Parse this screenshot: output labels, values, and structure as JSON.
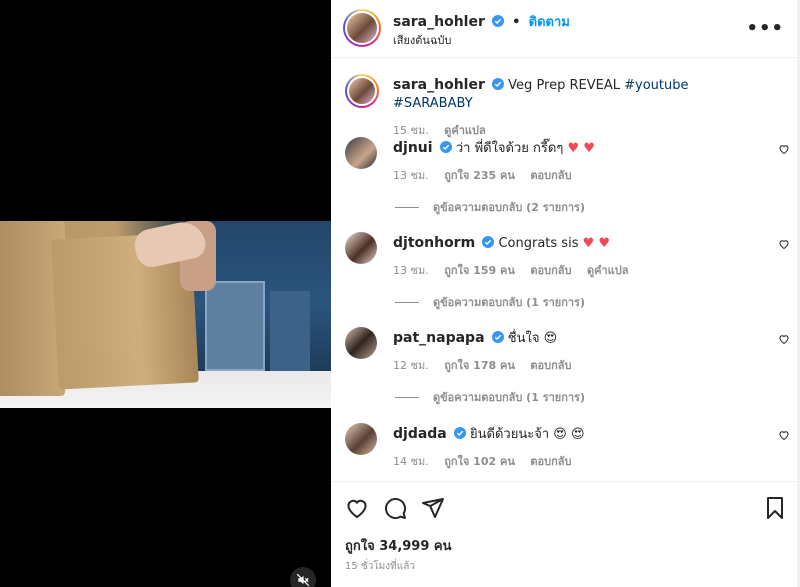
{
  "header": {
    "username": "sara_hohler",
    "follow_label": "ติดตาม",
    "dot": "•",
    "audio": "เสียงต้นฉบับ",
    "more": "•••"
  },
  "caption": {
    "username": "sara_hohler",
    "text": "Veg Prep REVEAL",
    "hashtags": "#youtube #SARABABY",
    "time": "15 ชม.",
    "translate": "ดูคำแปล"
  },
  "comments": [
    {
      "username": "djnui",
      "text": "ว่า พี่ดีใจด้วย กรี๊ดๆ",
      "emoji": "♥ ♥",
      "time": "13 ชม.",
      "likes": "ถูกใจ 235 คน",
      "reply": "ตอบกลับ",
      "view_replies": "ดูข้อความตอบกลับ (2 รายการ)"
    },
    {
      "username": "djtonhorm",
      "text": "Congrats sis",
      "emoji": "♥ ♥",
      "time": "13 ชม.",
      "likes": "ถูกใจ 159 คน",
      "reply": "ตอบกลับ",
      "translate": "ดูคำแปล",
      "view_replies": "ดูข้อความตอบกลับ (1 รายการ)"
    },
    {
      "username": "pat_napapa",
      "text": "ชื่นใจ",
      "emoji": "😍",
      "time": "12 ชม.",
      "likes": "ถูกใจ 178 คน",
      "reply": "ตอบกลับ",
      "view_replies": "ดูข้อความตอบกลับ (1 รายการ)"
    },
    {
      "username": "djdada",
      "text": "ยินดีด้วยนะจ้า",
      "emoji": "😍 😍",
      "time": "14 ชม.",
      "likes": "ถูกใจ 102 คน",
      "reply": "ตอบกลับ"
    }
  ],
  "footer": {
    "likes": "ถูกใจ 34,999 คน",
    "timestamp": "15 ชั่วโมงที่แล้ว"
  },
  "icons": {
    "like": "heart-icon",
    "comment": "comment-icon",
    "share": "paper-plane-icon",
    "save": "bookmark-icon",
    "mute": "speaker-muted-icon",
    "verified": "verified-badge-icon"
  },
  "colors": {
    "accent": "#0095f6",
    "heart": "#ed4956",
    "verified": "#3897f0",
    "muted_text": "#8e8e8e"
  }
}
